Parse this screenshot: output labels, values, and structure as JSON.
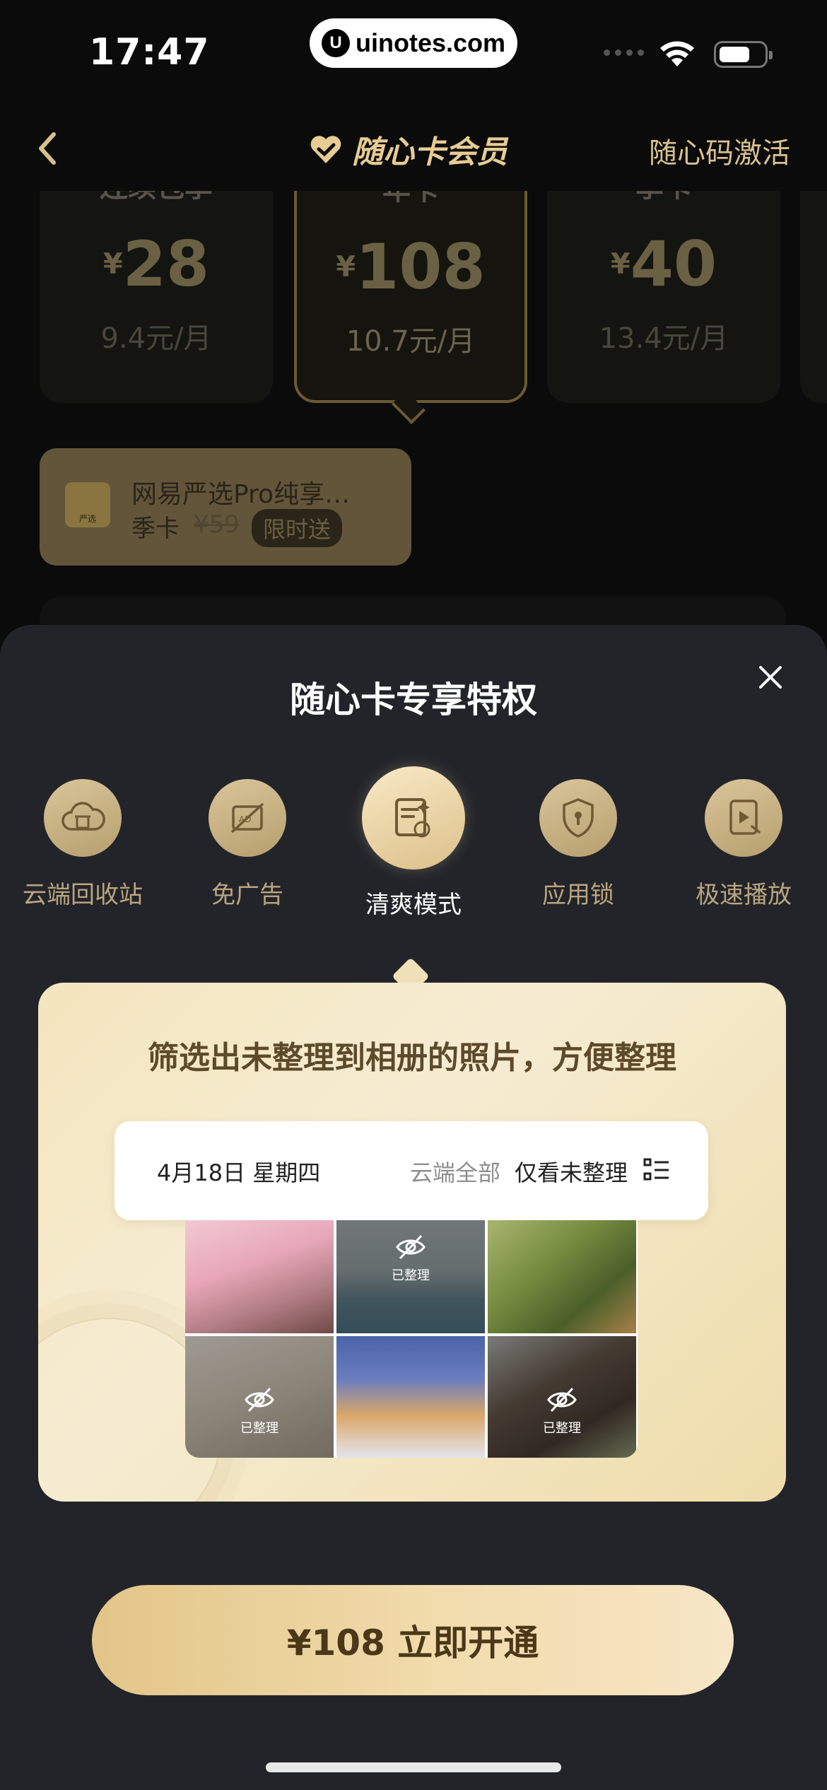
{
  "status": {
    "time": "17:47",
    "watermark": "uinotes.com",
    "watermark_logo": "U"
  },
  "nav": {
    "back_icon": "chevron-left-icon",
    "title": "随心卡会员",
    "activate": "随心码激活"
  },
  "plans": [
    {
      "name": "连续包季",
      "currency": "¥",
      "price": "28",
      "per_month": "9.4元/月",
      "selected": false
    },
    {
      "name": "年卡",
      "currency": "¥",
      "price": "108",
      "per_month": "10.7元/月",
      "selected": true
    },
    {
      "name": "季卡",
      "currency": "¥",
      "price": "40",
      "per_month": "13.4元/月",
      "selected": false
    }
  ],
  "promo": {
    "logo_text": "严选",
    "title": "网易严选Pro纯享…",
    "term": "季卡",
    "old_price": "¥59",
    "tag": "限时送"
  },
  "sheet": {
    "title": "随心卡专享特权",
    "perks": [
      {
        "label": "云端回收站",
        "icon": "cloud-trash-icon",
        "active": false
      },
      {
        "label": "免广告",
        "icon": "no-ads-icon",
        "active": false
      },
      {
        "label": "清爽模式",
        "icon": "clean-mode-icon",
        "active": true
      },
      {
        "label": "应用锁",
        "icon": "shield-lock-icon",
        "active": false
      },
      {
        "label": "极速播放",
        "icon": "fast-play-icon",
        "active": false
      }
    ],
    "card": {
      "headline": "筛选出未整理到相册的照片，方便整理",
      "date": "4月18日   星期四",
      "filter_all": "云端全部",
      "filter_unsorted": "仅看未整理",
      "organized_label": "已整理"
    }
  },
  "cta": {
    "label": "¥108 立即开通"
  },
  "colors": {
    "accent": "#e7cc93",
    "sheet_bg": "#23242a",
    "cta_text": "#4a3818"
  }
}
